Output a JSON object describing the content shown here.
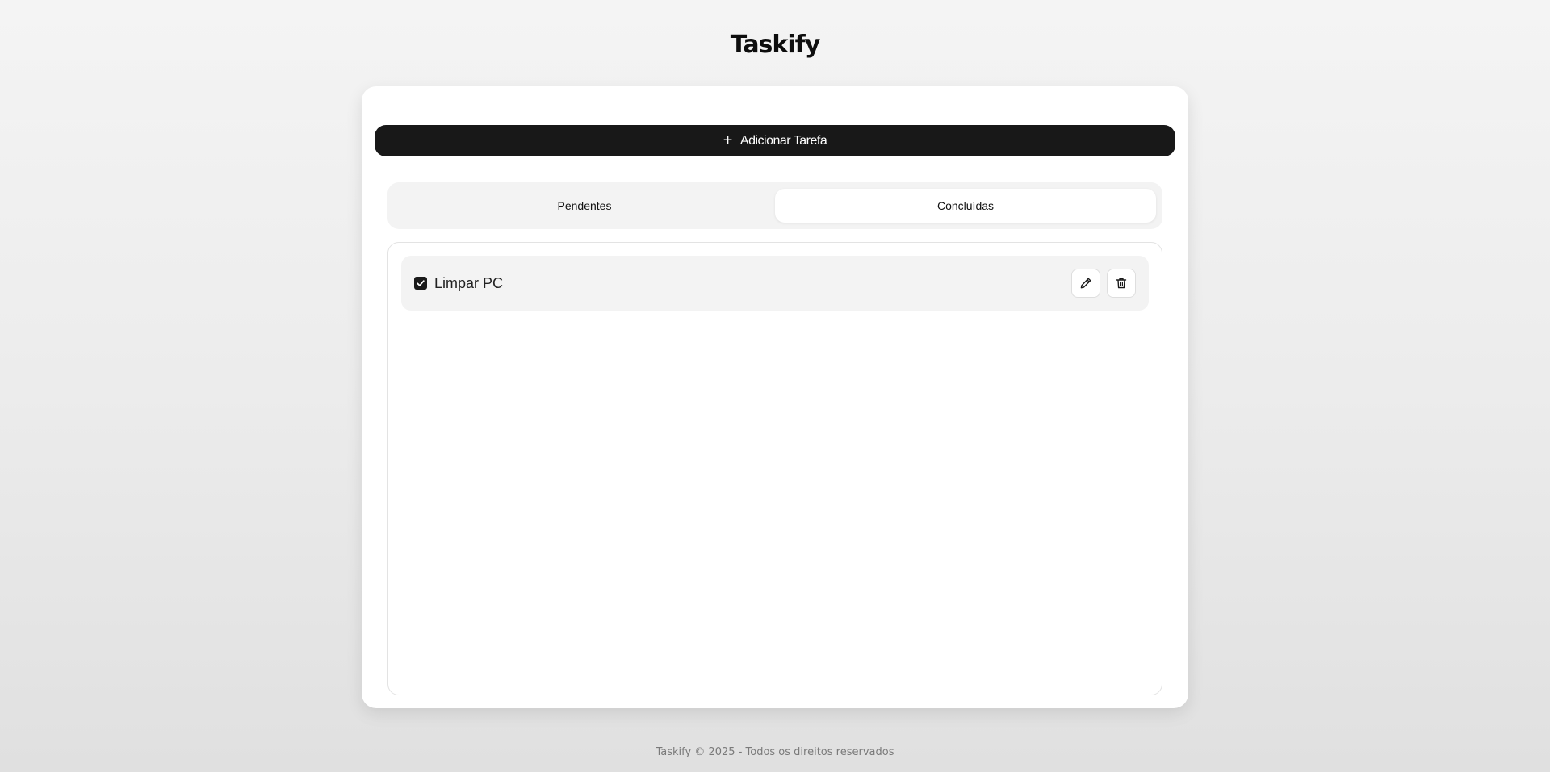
{
  "app": {
    "title": "Taskify"
  },
  "toolbar": {
    "add_icon": "plus-icon",
    "add_label": "Adicionar Tarefa"
  },
  "tabs": [
    {
      "label": "Pendentes",
      "active": false
    },
    {
      "label": "Concluídas",
      "active": true
    }
  ],
  "tasks": [
    {
      "label": "Limpar PC",
      "checked": true,
      "edit_icon": "pencil-icon",
      "delete_icon": "trash-icon"
    }
  ],
  "footer": {
    "text": "Taskify © 2025 - Todos os direitos reservados"
  },
  "colors": {
    "accent": "#181818",
    "card": "#ffffff",
    "tabs_bg": "#f3f3f3"
  }
}
